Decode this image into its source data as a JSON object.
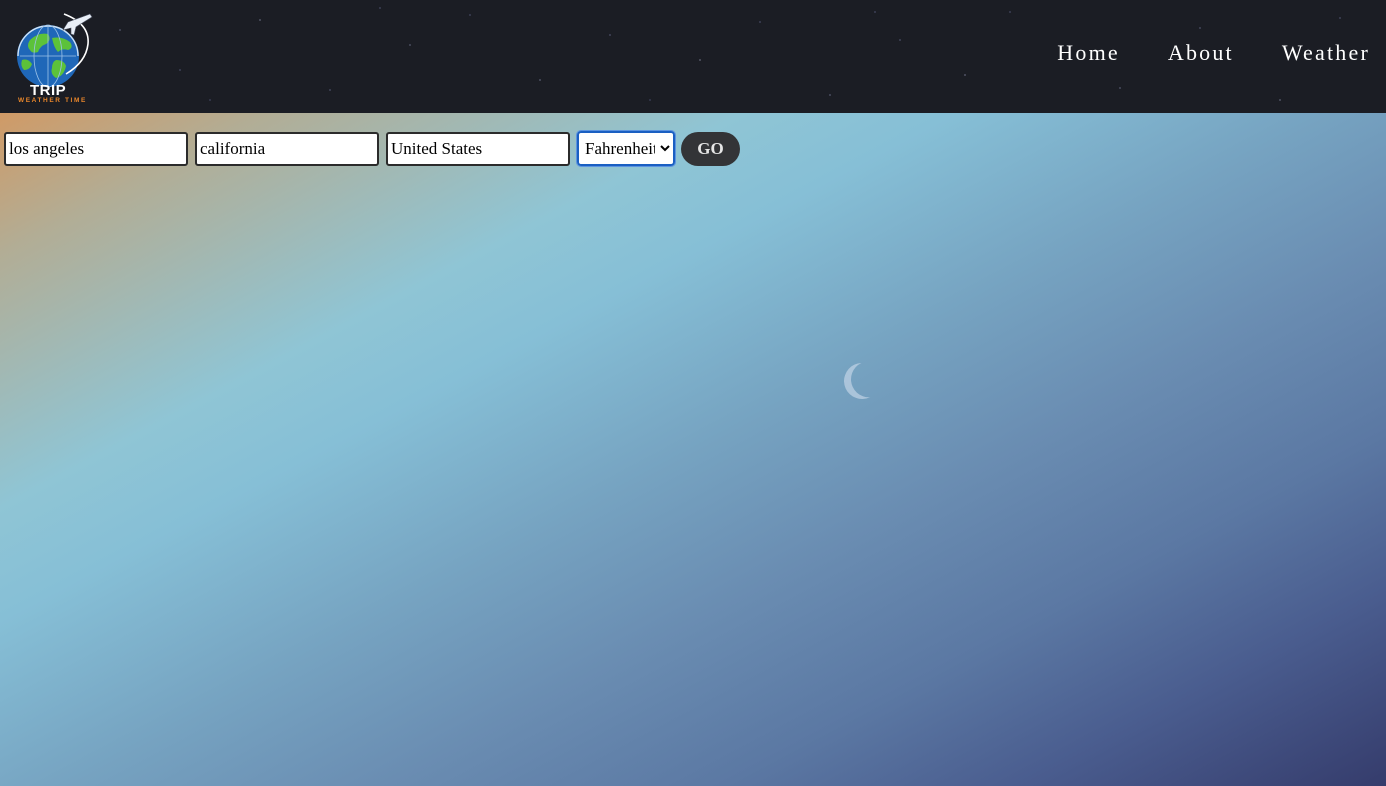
{
  "logo": {
    "name": "TRIP",
    "tagline": "WEATHER TIME",
    "icon": "globe-airplane-icon"
  },
  "nav": {
    "items": [
      {
        "label": "Home"
      },
      {
        "label": "About"
      },
      {
        "label": "Weather"
      }
    ]
  },
  "search": {
    "city": {
      "value": "los angeles"
    },
    "state": {
      "value": "california"
    },
    "country": {
      "value": "United States"
    },
    "unit": {
      "selected": "Fahrenheit",
      "options": [
        "Fahrenheit"
      ]
    },
    "go_label": "GO"
  },
  "colors": {
    "header_bg": "#1b1d24",
    "button_bg": "#333437",
    "select_focus": "#1a5fc2",
    "logo_orange": "#e8862b",
    "globe_green": "#5cc23a",
    "globe_blue": "#1f67b8"
  }
}
